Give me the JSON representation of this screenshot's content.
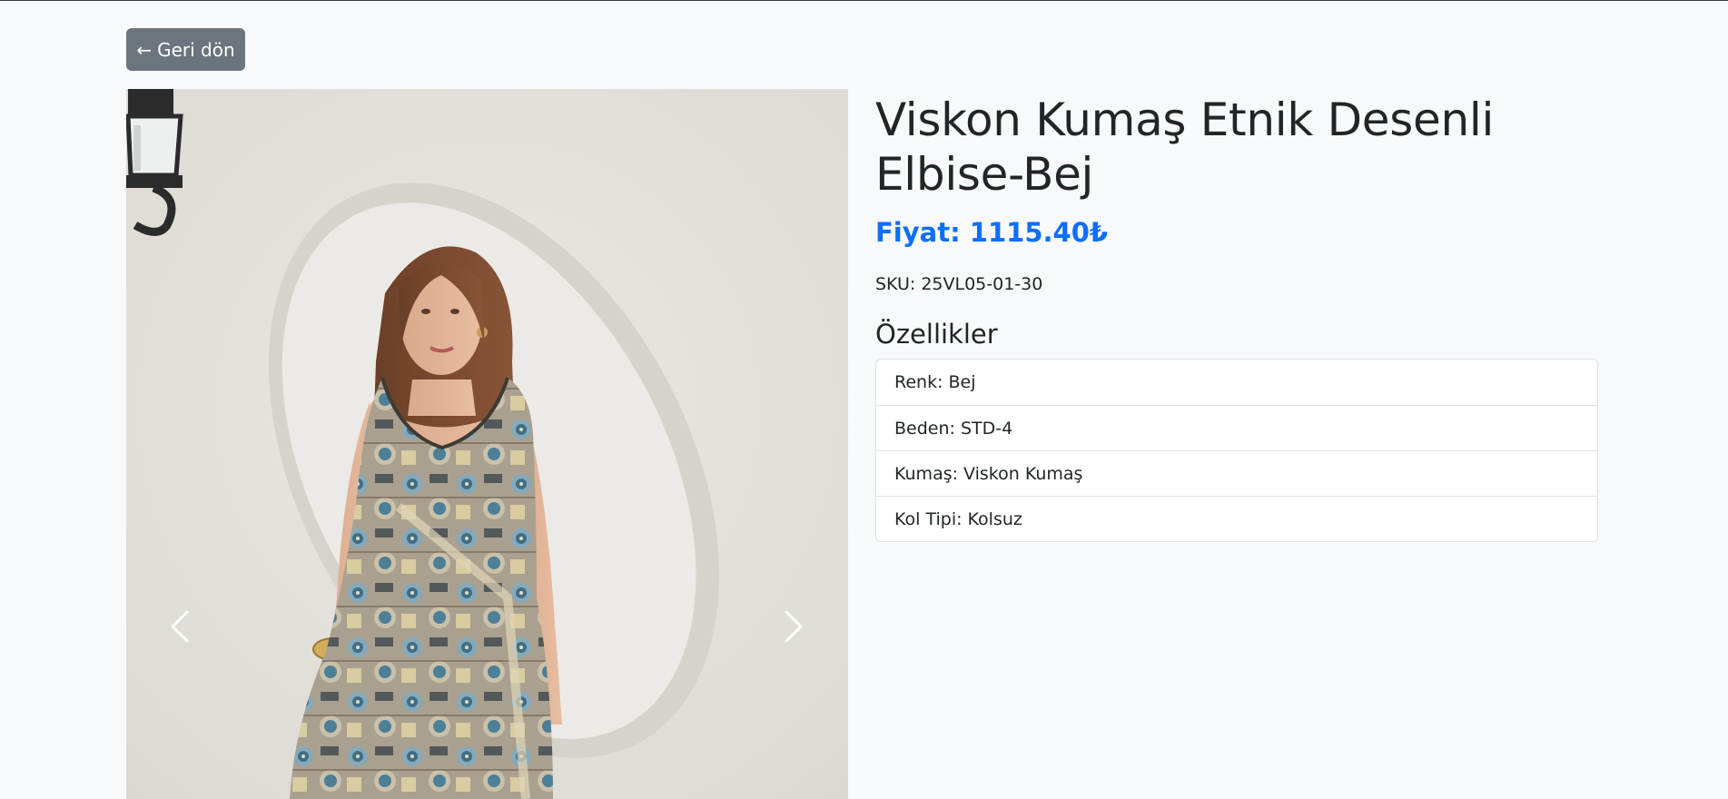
{
  "back_button": {
    "arrow": "←",
    "label": "Geri dön"
  },
  "product": {
    "title": "Viskon Kumaş Etnik Desenli Elbise-Bej",
    "price": "Fiyat: 1115.40₺",
    "sku_label": "SKU:",
    "sku_value": "25VL05-01-30"
  },
  "features": {
    "heading": "Özellikler",
    "items": [
      {
        "label": "Renk: Bej"
      },
      {
        "label": "Beden: STD-4"
      },
      {
        "label": "Kumaş: Viskon Kumaş"
      },
      {
        "label": "Kol Tipi: Kolsuz"
      }
    ]
  },
  "carousel": {
    "prev_icon": "chevron-left-icon",
    "next_icon": "chevron-right-icon"
  },
  "colors": {
    "background": "#f8f9fa",
    "button_secondary": "#6c757d",
    "price_blue": "#0d6efd",
    "text": "#212529",
    "border": "#dee2e6"
  }
}
